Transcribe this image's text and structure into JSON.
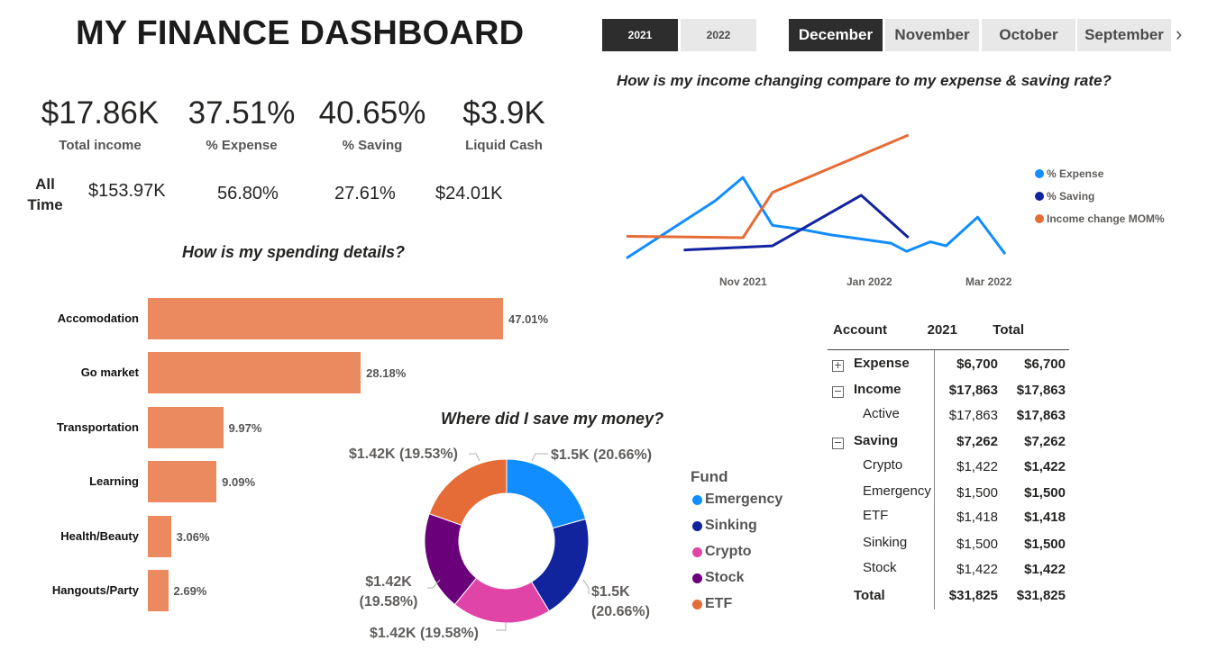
{
  "header": {
    "title": "MY FINANCE DASHBOARD"
  },
  "year_slicer": {
    "items": [
      {
        "label": "2021",
        "selected": true
      },
      {
        "label": "2022",
        "selected": false
      }
    ]
  },
  "month_slicer": {
    "items": [
      {
        "label": "December",
        "selected": true
      },
      {
        "label": "November",
        "selected": false
      },
      {
        "label": "October",
        "selected": false
      },
      {
        "label": "September",
        "selected": false
      }
    ]
  },
  "kpis": [
    {
      "value": "$17.86K",
      "label": "Total income"
    },
    {
      "value": "37.51%",
      "label": "% Expense"
    },
    {
      "value": "40.65%",
      "label": "% Saving"
    },
    {
      "value": "$3.9K",
      "label": "Liquid Cash"
    }
  ],
  "all_time": {
    "label": "All Time",
    "values": [
      "$153.97K",
      "56.80%",
      "27.61%",
      "$24.01K"
    ]
  },
  "colors": {
    "bar": "#eb8a5f",
    "slicer_selected": "#2d2d2d",
    "slicer_unselected": "#e8e8e8"
  },
  "spending_chart": {
    "title": "How is my spending details?",
    "chart_data": {
      "type": "bar",
      "orientation": "horizontal",
      "categories": [
        "Accomodation",
        "Go market",
        "Transportation",
        "Learning",
        "Health/Beauty",
        "Hangouts/Party"
      ],
      "values": [
        47.01,
        28.18,
        9.97,
        9.09,
        3.06,
        2.69
      ],
      "labels": [
        "47.01%",
        "28.18%",
        "9.97%",
        "9.09%",
        "3.06%",
        "2.69%"
      ],
      "color": "#eb8a5f"
    }
  },
  "saving_chart": {
    "title": "Where did I save my money?",
    "legend_title": "Fund",
    "chart_data": {
      "type": "pie",
      "donut": true,
      "categories": [
        "Emergency",
        "Sinking",
        "Crypto",
        "Stock",
        "ETF"
      ],
      "values": [
        1500,
        1500,
        1422,
        1418,
        1422
      ],
      "colors": [
        "#118dff",
        "#12239e",
        "#e044a7",
        "#6b007b",
        "#e66c37"
      ],
      "labels": [
        "$1.5K (20.66%)",
        "$1.5K (20.66%)",
        "$1.42K (19.58%)",
        "$1.42K (19.58%)",
        "$1.42K (19.53%)"
      ]
    }
  },
  "income_chart": {
    "title": "How is my income changing compare to my expense & saving rate?",
    "chart_data": {
      "type": "line",
      "x_ticks": [
        "Nov 2021",
        "Jan 2022",
        "Mar 2022"
      ],
      "series": [
        {
          "name": "% Expense",
          "color": "#118dff",
          "points": [
            [
              "2021-09-15",
              10
            ],
            [
              "2021-10-30",
              52
            ],
            [
              "2021-11-13",
              69
            ],
            [
              "2021-11-28",
              34
            ],
            [
              "2021-12-13",
              31
            ],
            [
              "2021-12-28",
              27
            ],
            [
              "2022-01-12",
              24
            ],
            [
              "2022-01-27",
              21
            ],
            [
              "2022-02-04",
              15
            ],
            [
              "2022-02-16",
              22
            ],
            [
              "2022-02-24",
              19
            ],
            [
              "2022-03-12",
              40
            ],
            [
              "2022-03-26",
              13
            ]
          ]
        },
        {
          "name": "% Saving",
          "color": "#12239e",
          "points": [
            [
              "2021-10-14",
              16
            ],
            [
              "2021-11-28",
              19
            ],
            [
              "2022-01-12",
              56
            ],
            [
              "2022-02-05",
              25
            ]
          ]
        },
        {
          "name": "Income change MOM%",
          "color": "#e66c37",
          "points": [
            [
              "2021-09-15",
              26
            ],
            [
              "2021-11-13",
              25
            ],
            [
              "2021-11-28",
              58
            ],
            [
              "2022-02-05",
              100
            ]
          ]
        }
      ]
    }
  },
  "matrix": {
    "headers": [
      "Account",
      "2021",
      "Total"
    ],
    "rows": [
      {
        "label": "Expense",
        "v2021": "$6,700",
        "total": "$6,700",
        "level": 0,
        "expander": "+"
      },
      {
        "label": "Income",
        "v2021": "$17,863",
        "total": "$17,863",
        "level": 0,
        "expander": "−"
      },
      {
        "label": "Active",
        "v2021": "$17,863",
        "total": "$17,863",
        "level": 1
      },
      {
        "label": "Saving",
        "v2021": "$7,262",
        "total": "$7,262",
        "level": 0,
        "expander": "−"
      },
      {
        "label": "Crypto",
        "v2021": "$1,422",
        "total": "$1,422",
        "level": 1
      },
      {
        "label": "Emergency",
        "v2021": "$1,500",
        "total": "$1,500",
        "level": 1
      },
      {
        "label": "ETF",
        "v2021": "$1,418",
        "total": "$1,418",
        "level": 1
      },
      {
        "label": "Sinking",
        "v2021": "$1,500",
        "total": "$1,500",
        "level": 1
      },
      {
        "label": "Stock",
        "v2021": "$1,422",
        "total": "$1,422",
        "level": 1
      }
    ],
    "total": {
      "label": "Total",
      "v2021": "$31,825",
      "total": "$31,825"
    }
  }
}
